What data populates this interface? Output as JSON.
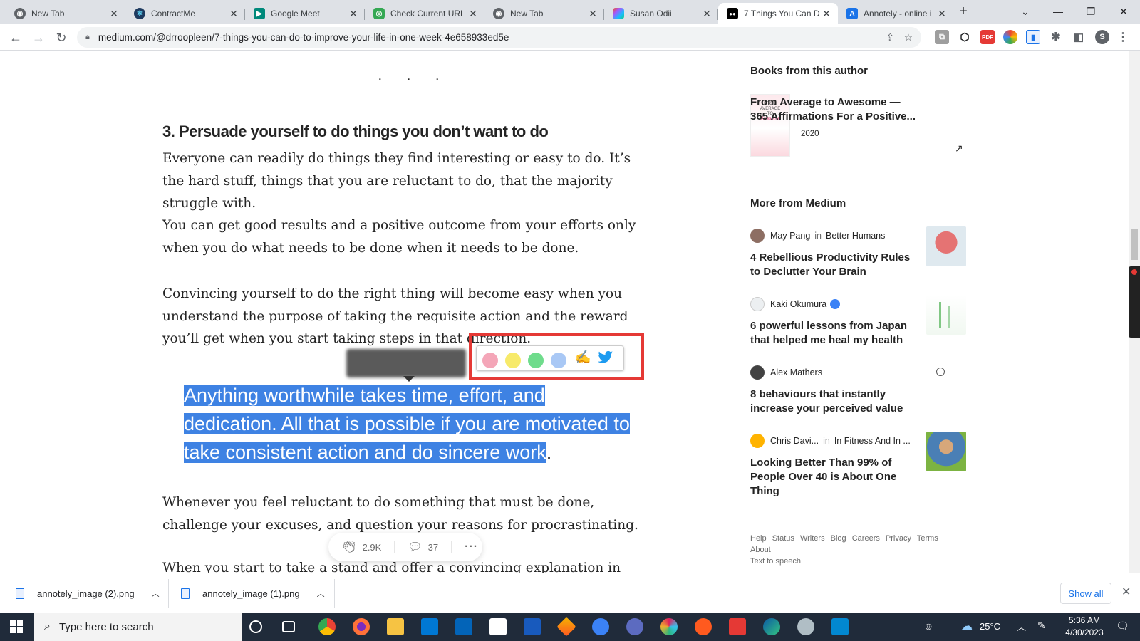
{
  "tabs": [
    {
      "title": "New Tab",
      "icon": "chrome-icon"
    },
    {
      "title": "ContractMe",
      "icon": "react-icon"
    },
    {
      "title": "Google Meet",
      "icon": "meet-icon"
    },
    {
      "title": "Check Current URL",
      "icon": "extension-icon"
    },
    {
      "title": "New Tab",
      "icon": "chrome-icon"
    },
    {
      "title": "Susan Odii",
      "icon": "figma-icon"
    },
    {
      "title": "7 Things You Can D",
      "icon": "medium-icon"
    },
    {
      "title": "Annotely - online i",
      "icon": "annotely-icon"
    }
  ],
  "address_bar": {
    "url": "medium.com/@drroopleen/7-things-you-can-do-to-improve-your-life-in-one-week-4e658933ed5e"
  },
  "profile_initial": "S",
  "article": {
    "separator": "· · ·",
    "heading": "3. Persuade yourself to do things you don’t want to do",
    "paragraphs": [
      "Everyone can readily do things they find interesting or easy to do. It’s the hard stuff, things that you are reluctant to do, that the majority struggle with.",
      "You can get good results and a positive outcome from your efforts only when you do what needs to be done when it needs to be done.",
      "Convincing yourself to do the right thing will become easy when you understand the purpose of taking the requisite action and the reward you’ll get when you start taking steps in that direction."
    ],
    "quote_lines": [
      "Anything worthwhile takes time, effort, and",
      "dedication. All that is possible if you are motivated to",
      "take consistent action and do sincere work"
    ],
    "quote_end": ".",
    "paragraph_after": "Whenever you feel reluctant to do something that must be done, challenge your excuses, and question your reasons for procrastinating.",
    "paragraph_cut": "When you start to take a stand and offer a convincing explanation in favor of"
  },
  "annotation_toolbar": {
    "colors": [
      "#f4a6b8",
      "#f7ea6a",
      "#6fdc8c",
      "#a9c8f5"
    ],
    "highlight_icon": "highlighter-icon",
    "share_icon": "twitter-icon"
  },
  "engagement": {
    "claps": "2.9K",
    "comments": "37"
  },
  "sidebar": {
    "books_heading": "Books from this author",
    "book": {
      "title": "From Average to Awesome — 365 Affirmations For a Positive...",
      "year": "2020"
    },
    "more_heading": "More from Medium",
    "recommendations": [
      {
        "author": "May Pang",
        "in": "in",
        "publication": "Better Humans",
        "title": "4 Rebellious Productivity Rules to Declutter Your Brain"
      },
      {
        "author": "Kaki Okumura",
        "in": "",
        "publication": "",
        "title": "6 powerful lessons from Japan that helped me heal my health"
      },
      {
        "author": "Alex Mathers",
        "in": "",
        "publication": "",
        "title": "8 behaviours that instantly increase your perceived value"
      },
      {
        "author": "Chris Davi...",
        "in": "in",
        "publication": "In Fitness And In ...",
        "title": "Looking Better Than 99% of People Over 40 is About One Thing"
      }
    ],
    "footer_links": [
      "Help",
      "Status",
      "Writers",
      "Blog",
      "Careers",
      "Privacy",
      "Terms",
      "About",
      "Text to speech"
    ]
  },
  "downloads": {
    "items": [
      "annotely_image (2).png",
      "annotely_image (1).png"
    ],
    "show_all": "Show all"
  },
  "taskbar": {
    "search_placeholder": "Type here to search",
    "temperature": "25°C",
    "time": "5:36 AM",
    "date": "4/30/2023"
  }
}
